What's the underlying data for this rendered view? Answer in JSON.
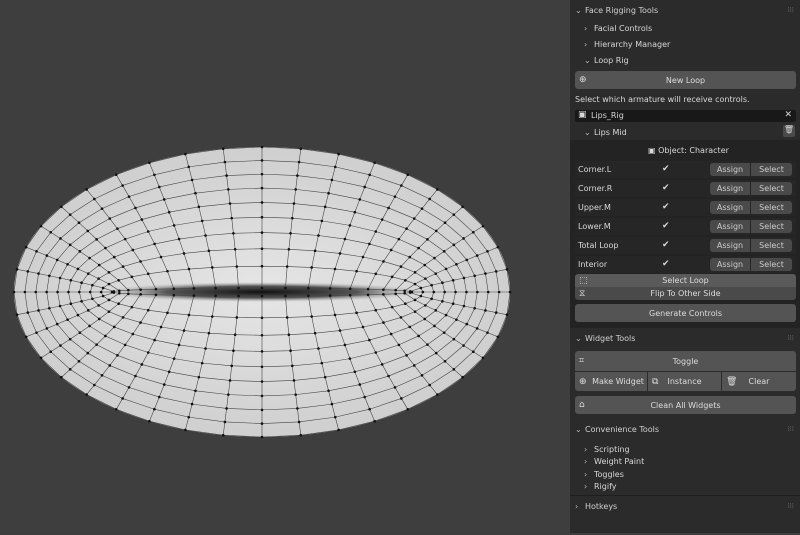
{
  "panel": {
    "face_rigging": {
      "title": "Face Rigging Tools",
      "items": [
        "Facial Controls",
        "Hierarchy Manager"
      ],
      "loop_rig": "Loop Rig"
    },
    "new_loop": "New Loop",
    "instruction": "Select which armature will receive controls.",
    "armature_field": "Lips_Rig",
    "lips_mid": "Lips Mid",
    "object_label": "Object: Character",
    "rows": [
      {
        "label": "Corner.L",
        "checked": "✔",
        "assign": "Assign",
        "select": "Select"
      },
      {
        "label": "Corner.R",
        "checked": "✔",
        "assign": "Assign",
        "select": "Select"
      },
      {
        "label": "Upper.M",
        "checked": "✔",
        "assign": "Assign",
        "select": "Select"
      },
      {
        "label": "Lower.M",
        "checked": "✔",
        "assign": "Assign",
        "select": "Select"
      },
      {
        "label": "Total Loop",
        "checked": "✔",
        "assign": "Assign",
        "select": "Select"
      },
      {
        "label": "Interior",
        "checked": "✔",
        "assign": "Assign",
        "select": "Select"
      }
    ],
    "select_loop": "Select Loop",
    "flip": "Flip To Other Side",
    "generate": "Generate Controls",
    "widget_tools": {
      "title": "Widget Tools",
      "toggle": "Toggle",
      "make": "Make Widget",
      "instance": "Instance",
      "clear": "Clear",
      "clean_all": "Clean All Widgets"
    },
    "convenience": {
      "title": "Convenience Tools",
      "items": [
        "Scripting",
        "Weight Paint",
        "Toggles",
        "Rigify"
      ]
    },
    "hotkeys": "Hotkeys"
  }
}
